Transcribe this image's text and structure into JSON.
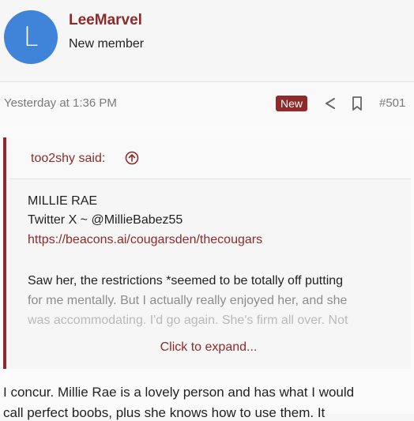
{
  "user": {
    "avatar_letter": "L",
    "name": "LeeMarvel",
    "title": "New member"
  },
  "meta": {
    "timestamp": "Yesterday at 1:36 PM",
    "badge": "New",
    "post_number": "#501",
    "icons": [
      "share-icon",
      "bookmark-icon"
    ]
  },
  "quote": {
    "author": "too2shy said:",
    "lines": [
      "MILLIE RAE",
      "Twitter X ~ @MillieBabez55",
      "https://beacons.ai/cougarsden/thecougars",
      "Saw her, the restrictions *seemed to be totally off putting",
      "for me mentally. But I actually really enjoyed her, and she",
      "was accommodating. I'd go again. She's firm all over. Not"
    ],
    "expand_label": "Click to expand..."
  },
  "reply": {
    "lines": [
      "I concur. Millie Rae is a lovely person and has what I would",
      "call perfect boobs, plus she knows how to use them. It"
    ]
  },
  "colors": {
    "accent": "#8f2a2a",
    "avatar_bg": "#3f84d8",
    "muted": "#7a7a7a"
  }
}
